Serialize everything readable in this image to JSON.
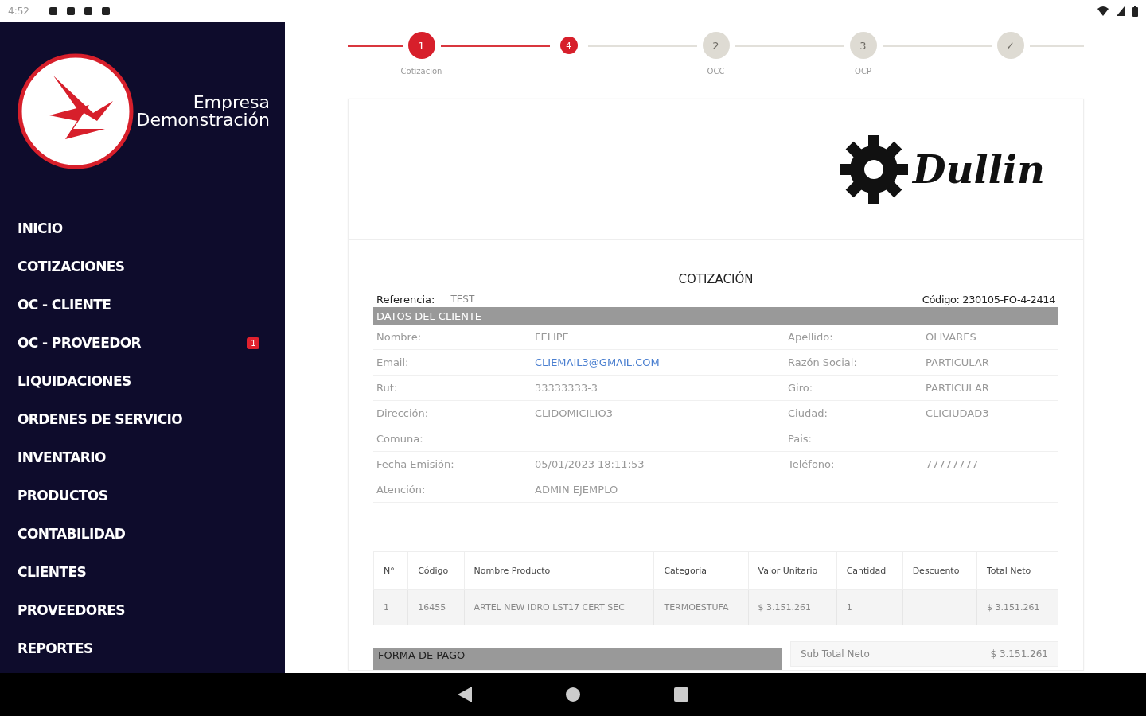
{
  "status_bar": {
    "time": "4:52"
  },
  "sidebar": {
    "company": "Empresa Demonstración",
    "items": [
      {
        "label": "INICIO",
        "selected": false
      },
      {
        "label": "COTIZACIONES",
        "selected": false
      },
      {
        "label": "OC - CLIENTE",
        "selected": false
      },
      {
        "label": "OC - PROVEEDOR",
        "selected": false,
        "badge": "1"
      },
      {
        "label": "LIQUIDACIONES",
        "selected": false
      },
      {
        "label": "ORDENES DE SERVICIO",
        "selected": false
      },
      {
        "label": "INVENTARIO",
        "selected": false
      },
      {
        "label": "PRODUCTOS",
        "selected": false
      },
      {
        "label": "CONTABILIDAD",
        "selected": false
      },
      {
        "label": "CLIENTES",
        "selected": false
      },
      {
        "label": "PROVEEDORES",
        "selected": false
      },
      {
        "label": "REPORTES",
        "selected": false
      }
    ]
  },
  "stepper": [
    {
      "marker": "1",
      "label": "Cotizacion",
      "reached": true,
      "kind": "main"
    },
    {
      "marker": "4",
      "reached": true,
      "kind": "sub"
    },
    {
      "marker": "2",
      "label": "OCC",
      "reached": false,
      "kind": "main"
    },
    {
      "marker": "3",
      "label": "OCP",
      "reached": false,
      "kind": "main"
    },
    {
      "marker": "✓",
      "reached": false,
      "kind": "main"
    }
  ],
  "document": {
    "logo_text": "Dullin",
    "title": "COTIZACIÓN",
    "reference_label": "Referencia:",
    "reference_value": "TEST",
    "code": "Código: 230105-FO-4-2414",
    "section": "DATOS DEL CLIENTE",
    "client_rows": [
      {
        "kind": "plain",
        "label_1": "Nombre:",
        "value_1": "FELIPE",
        "label_2": "Apellido:",
        "value_2": "OLIVARES"
      },
      {
        "kind": "email",
        "label_1": "Email:",
        "value_1": "CLIEMAIL3@GMAIL.COM",
        "label_2": "Razón Social:",
        "value_2": "PARTICULAR"
      },
      {
        "kind": "plain",
        "label_1": "Rut:",
        "value_1": "33333333-3",
        "label_2": "Giro:",
        "value_2": "PARTICULAR"
      },
      {
        "kind": "plain",
        "label_1": "Dirección:",
        "value_1": "CLIDOMICILIO3",
        "label_2": "Ciudad:",
        "value_2": "CLICIUDAD3"
      },
      {
        "label_1": "Comuna:",
        "label_2": "Pais:"
      },
      {
        "kind": "plain",
        "label_1": "Fecha Emisión:",
        "value_1": "05/01/2023 18:11:53",
        "label_2": "Teléfono:",
        "value_2": "77777777"
      },
      {
        "kind": "plain",
        "label_1": "Atención:",
        "value_1": "ADMIN EJEMPLO"
      }
    ],
    "table": {
      "columns": [
        "N°",
        "Código",
        "Nombre Producto",
        "Categoria",
        "Valor Unitario",
        "Cantidad",
        "Descuento",
        "Total Neto"
      ],
      "rows": [
        [
          "1",
          "16455",
          "ARTEL NEW IDRO LST17 CERT SEC",
          "TERMOESTUFA",
          "$ 3.151.261",
          "1",
          "",
          "$ 3.151.261"
        ]
      ]
    },
    "payment_section": "FORMA DE PAGO",
    "totals": [
      {
        "label": "Sub Total Neto",
        "value": "$ 3.151.261"
      }
    ]
  }
}
